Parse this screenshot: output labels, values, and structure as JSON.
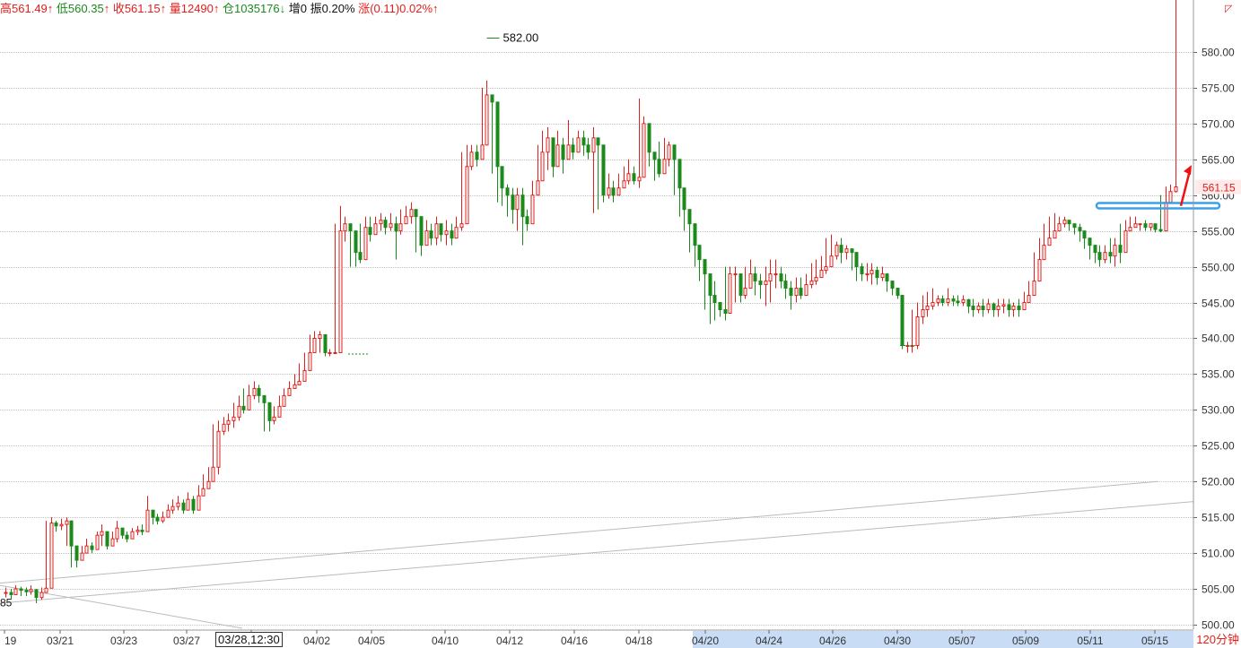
{
  "info": {
    "high_label": "高",
    "high_value": "561.49",
    "high_arrow": "↑",
    "low_label": "低",
    "low_value": "560.35",
    "low_arrow": "↑",
    "close_label": "收",
    "close_value": "561.15",
    "close_arrow": "↑",
    "volume_label": "量",
    "volume_value": "12490",
    "volume_arrow": "↑",
    "oi_label": "仓",
    "oi_value": "1035176",
    "oi_arrow": "↓",
    "oi_change_label": "增",
    "oi_change_value": "0",
    "amplitude_label": "振",
    "amplitude_value": "0.20%",
    "change_label": "涨",
    "change_value": "(0.11)0.02%",
    "change_arrow": "↑"
  },
  "period_label": "120分钟",
  "cursor_time": "03/28,12:30",
  "colors": {
    "up": "#e0201c",
    "down": "#1a8a1a",
    "grid": "#888888",
    "highlight": "#3aa0e8"
  },
  "chart_data": {
    "type": "candlestick",
    "ylim": [
      500,
      582.5
    ],
    "y_ticks": [
      "500.00",
      "505.00",
      "510.00",
      "515.00",
      "520.00",
      "525.00",
      "530.00",
      "535.00",
      "540.00",
      "545.00",
      "550.00",
      "555.00",
      "560.00",
      "565.00",
      "570.00",
      "575.00",
      "580.00"
    ],
    "x_ticks": [
      "19",
      "03/21",
      "03/23",
      "03/27",
      "03/28,12:30",
      "04/02",
      "04/05",
      "04/10",
      "04/12",
      "04/16",
      "04/18",
      "04/20",
      "04/24",
      "04/26",
      "04/30",
      "05/07",
      "05/09",
      "05/11",
      "05/15"
    ],
    "max_annotation": "582.00",
    "low_annotation": "85",
    "last_price": "561.15",
    "closes": [
      504.5,
      504.2,
      505.0,
      504.8,
      504.6,
      504.9,
      503.8,
      504.5,
      505.1,
      514.2,
      513.8,
      514.0,
      514.5,
      511.0,
      509.0,
      510.0,
      511.0,
      510.5,
      512.5,
      513.0,
      511.0,
      512.0,
      513.5,
      512.5,
      512.0,
      513.0,
      513.2,
      513.0,
      516.0,
      515.0,
      514.5,
      515.0,
      516.0,
      516.5,
      517.0,
      516.0,
      517.5,
      516.0,
      518.0,
      519.0,
      520.0,
      522.0,
      527.0,
      528.0,
      528.5,
      529.0,
      530.5,
      530.0,
      532.0,
      533.0,
      532.0,
      531.0,
      528.5,
      529.0,
      530.5,
      532.0,
      533.0,
      533.5,
      534.0,
      535.5,
      538.0,
      540.0,
      540.5,
      538.0,
      538.0,
      538.0,
      555.0,
      556.0,
      555.0,
      552.0,
      551.0,
      555.5,
      554.5,
      556.0,
      556.5,
      555.5,
      556.0,
      555.0,
      556.0,
      557.0,
      558.0,
      557.0,
      553.0,
      555.0,
      554.0,
      556.0,
      554.5,
      555.0,
      554.0,
      555.5,
      556.0,
      564.0,
      566.0,
      565.0,
      567.0,
      574.0,
      573.0,
      564.0,
      561.0,
      560.0,
      558.0,
      560.0,
      557.0,
      556.0,
      560.0,
      562.0,
      566.0,
      568.0,
      564.0,
      567.0,
      565.0,
      567.0,
      566.0,
      568.0,
      567.0,
      566.0,
      568.0,
      567.0,
      560.0,
      561.0,
      560.0,
      561.0,
      562.0,
      563.0,
      562.0,
      562.5,
      570.0,
      566.0,
      565.0,
      563.0,
      565.0,
      567.0,
      565.0,
      561.0,
      558.0,
      556.0,
      553.0,
      551.0,
      549.0,
      546.0,
      545.0,
      544.0,
      543.5,
      549.0,
      549.0,
      546.0,
      547.0,
      549.0,
      548.0,
      547.5,
      548.0,
      549.0,
      549.0,
      548.0,
      547.0,
      546.0,
      547.0,
      546.0,
      547.5,
      548.0,
      548.5,
      549.5,
      550.0,
      551.5,
      553.0,
      552.0,
      552.5,
      552.0,
      550.0,
      549.0,
      549.0,
      549.5,
      548.5,
      549.0,
      548.0,
      547.0,
      546.0,
      539.0,
      539.0,
      539.0,
      543.0,
      544.0,
      544.5,
      545.0,
      545.5,
      545.0,
      545.5,
      545.2,
      545.0,
      545.4,
      544.5,
      544.0,
      544.5,
      544.0,
      544.8,
      544.0,
      544.5,
      544.7,
      544.0,
      544.5,
      544.0,
      545.0,
      546.0,
      548.0,
      551.0,
      553.0,
      554.0,
      555.0,
      556.0,
      556.5,
      556.0,
      555.5,
      555.0,
      554.0,
      553.0,
      552.0,
      551.0,
      552.0,
      551.5,
      553.0,
      552.0,
      555.0,
      555.5,
      556.0,
      556.0,
      555.5,
      556.0,
      555.2,
      555.0,
      559.0,
      560.5,
      561.15
    ],
    "highs": [
      505.2,
      505.0,
      505.5,
      505.3,
      505.2,
      505.5,
      505.0,
      505.2,
      514.5,
      515.0,
      514.5,
      514.8,
      515.0,
      513.0,
      511.0,
      511.0,
      512.0,
      511.5,
      513.0,
      514.0,
      513.0,
      513.0,
      514.5,
      513.5,
      513.0,
      513.5,
      513.8,
      514.0,
      518.0,
      516.0,
      515.5,
      515.8,
      516.8,
      517.5,
      518.0,
      517.5,
      518.5,
      518.0,
      519.5,
      521.0,
      522.0,
      528.0,
      528.5,
      529.0,
      529.5,
      531.0,
      532.0,
      533.0,
      533.5,
      534.0,
      533.5,
      532.0,
      531.0,
      530.5,
      532.0,
      533.0,
      534.0,
      535.0,
      536.5,
      538.0,
      540.5,
      541.0,
      541.0,
      539.0,
      538.5,
      556.0,
      558.5,
      557.0,
      556.0,
      554.0,
      556.0,
      557.0,
      557.0,
      557.0,
      557.5,
      557.0,
      557.5,
      557.0,
      558.0,
      558.5,
      559.0,
      558.0,
      556.0,
      556.5,
      556.0,
      557.0,
      556.0,
      556.5,
      556.0,
      557.0,
      566.0,
      567.0,
      567.0,
      567.0,
      575.0,
      576.0,
      574.0,
      569.0,
      563.0,
      561.5,
      561.0,
      561.0,
      561.0,
      558.0,
      562.0,
      567.0,
      569.0,
      569.5,
      568.0,
      569.0,
      568.0,
      570.5,
      568.0,
      569.0,
      569.0,
      568.0,
      569.5,
      568.0,
      563.0,
      563.0,
      562.0,
      563.0,
      564.0,
      565.0,
      564.0,
      573.5,
      571.0,
      567.0,
      566.0,
      567.5,
      568.0,
      567.5,
      567.0,
      562.0,
      559.0,
      557.0,
      554.0,
      552.0,
      551.0,
      549.0,
      548.0,
      545.0,
      550.0,
      550.0,
      550.0,
      549.0,
      550.0,
      551.0,
      550.0,
      549.0,
      550.0,
      551.0,
      551.0,
      550.0,
      549.0,
      548.0,
      548.5,
      548.5,
      549.0,
      550.5,
      551.0,
      551.5,
      554.0,
      554.5,
      553.5,
      554.0,
      553.0,
      552.5,
      551.0,
      550.5,
      550.5,
      550.5,
      550.0,
      550.0,
      549.0,
      548.0,
      547.0,
      539.5,
      539.5,
      544.0,
      545.0,
      546.0,
      546.5,
      547.0,
      546.0,
      546.0,
      547.0,
      546.0,
      546.0,
      546.0,
      545.5,
      545.5,
      545.0,
      545.5,
      545.5,
      545.0,
      545.5,
      545.5,
      545.5,
      545.0,
      545.5,
      546.5,
      548.0,
      552.0,
      554.0,
      556.0,
      557.0,
      557.5,
      557.0,
      557.0,
      556.5,
      556.0,
      556.0,
      555.0,
      554.0,
      553.0,
      553.0,
      553.0,
      554.0,
      554.0,
      556.0,
      556.5,
      557.0,
      557.0,
      556.0,
      556.5,
      556.0,
      556.0,
      560.0,
      561.2,
      561.49
    ],
    "lows": [
      503.8,
      503.5,
      504.2,
      504.0,
      504.0,
      504.2,
      503.0,
      503.5,
      504.5,
      508.0,
      513.0,
      513.2,
      511.0,
      508.0,
      508.0,
      509.0,
      510.0,
      510.0,
      510.5,
      511.0,
      510.5,
      511.0,
      511.5,
      512.0,
      511.5,
      512.0,
      512.5,
      512.5,
      513.5,
      514.0,
      514.0,
      514.2,
      515.0,
      515.5,
      516.0,
      515.5,
      516.0,
      515.5,
      516.5,
      518.0,
      519.0,
      520.5,
      521.0,
      526.5,
      527.0,
      527.5,
      528.5,
      529.5,
      530.5,
      531.5,
      531.0,
      527.0,
      527.0,
      528.0,
      529.5,
      531.0,
      532.0,
      533.0,
      533.5,
      534.5,
      537.5,
      539.5,
      538.0,
      537.5,
      537.5,
      537.8,
      550.0,
      553.5,
      550.0,
      550.0,
      550.5,
      553.5,
      553.5,
      555.0,
      555.0,
      554.5,
      555.0,
      551.0,
      554.5,
      556.0,
      556.0,
      552.0,
      551.5,
      553.0,
      553.0,
      553.0,
      553.5,
      553.0,
      553.0,
      554.0,
      555.0,
      563.0,
      563.5,
      564.0,
      565.0,
      571.0,
      563.0,
      559.0,
      558.5,
      557.0,
      556.0,
      555.0,
      553.0,
      555.0,
      557.0,
      560.5,
      563.0,
      563.5,
      562.5,
      564.0,
      563.0,
      565.0,
      565.0,
      566.0,
      565.5,
      565.0,
      557.5,
      558.0,
      559.0,
      559.5,
      559.0,
      560.0,
      561.0,
      561.5,
      561.5,
      561.0,
      563.5,
      564.0,
      562.0,
      562.5,
      563.5,
      564.0,
      560.0,
      557.0,
      555.0,
      552.0,
      550.0,
      548.0,
      544.0,
      542.0,
      542.5,
      543.0,
      542.5,
      546.5,
      545.0,
      545.0,
      545.5,
      547.0,
      546.0,
      545.5,
      544.5,
      545.0,
      547.0,
      547.0,
      545.5,
      544.0,
      545.0,
      545.5,
      546.0,
      547.0,
      547.5,
      548.5,
      549.0,
      550.5,
      551.0,
      550.5,
      551.0,
      549.5,
      548.0,
      548.0,
      548.0,
      547.5,
      547.5,
      548.0,
      546.5,
      546.0,
      545.5,
      538.5,
      538.0,
      538.0,
      538.5,
      542.0,
      543.0,
      544.0,
      544.5,
      544.5,
      544.5,
      544.5,
      544.5,
      544.5,
      543.5,
      543.0,
      543.5,
      543.0,
      543.5,
      543.0,
      543.0,
      543.5,
      543.0,
      543.0,
      543.0,
      544.0,
      545.5,
      547.0,
      549.5,
      552.0,
      553.0,
      554.0,
      555.0,
      555.5,
      555.0,
      554.5,
      553.5,
      552.5,
      551.0,
      550.5,
      550.0,
      550.5,
      550.5,
      550.0,
      550.5,
      554.5,
      555.0,
      555.5,
      555.0,
      555.0,
      555.0,
      554.8,
      554.8,
      555.0,
      559.0,
      560.35
    ]
  }
}
